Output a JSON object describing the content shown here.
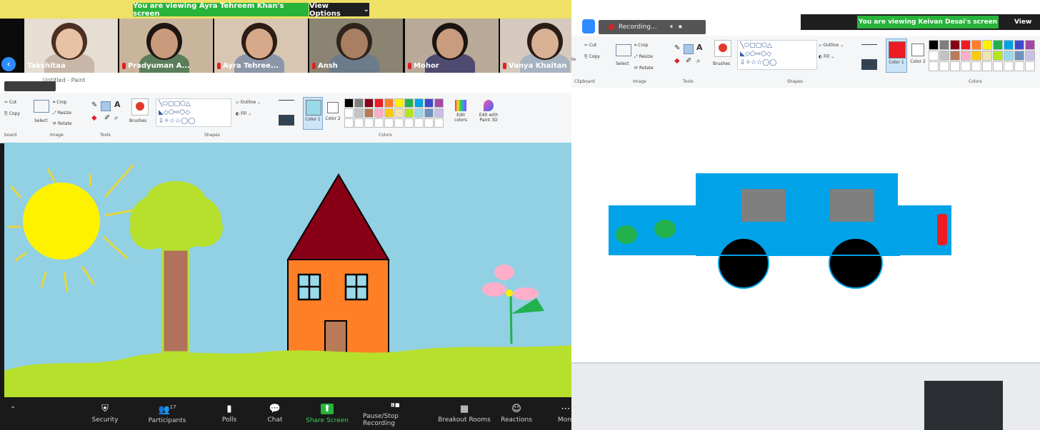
{
  "left_share": {
    "banner": "You are viewing Ayra Tehreem Khan's screen",
    "view_options": "View Options",
    "participants": [
      {
        "name": "Takshitaa",
        "muted": false,
        "bg": "#e6ddd3",
        "skin": "#e8c2a4",
        "hair": "#4a2f22",
        "shirt": "#c8b7a8"
      },
      {
        "name": "Pradyuman A...",
        "muted": true,
        "bg": "#c9b59c",
        "skin": "#c99a7c",
        "hair": "#1d1612",
        "shirt": "#5c7d5a"
      },
      {
        "name": "Ayra Tehree...",
        "muted": true,
        "bg": "#d8c6b3",
        "skin": "#d6a98a",
        "hair": "#2b1c14",
        "shirt": "#8b96a8"
      },
      {
        "name": "Ansh",
        "muted": true,
        "bg": "#8c8472",
        "skin": "#a87f62",
        "hair": "#2d241c",
        "shirt": "#6c7b8a"
      },
      {
        "name": "Mohor",
        "muted": true,
        "bg": "#b9a999",
        "skin": "#c99b7f",
        "hair": "#1a1410",
        "shirt": "#4f4a70"
      },
      {
        "name": "Vanya Khaitan",
        "muted": true,
        "bg": "#d5cabd",
        "skin": "#d8b094",
        "hair": "#2a1d16",
        "shirt": "#a7b3c0"
      }
    ],
    "app_title": "Untitled - Paint",
    "ribbon": {
      "clipboard": {
        "cut": "Cut",
        "copy": "Copy",
        "group": "board"
      },
      "image": {
        "select": "Select",
        "crop": "Crop",
        "resize": "Resize",
        "rotate": "Rotate",
        "group": "Image"
      },
      "tools": {
        "group": "Tools"
      },
      "brushes": "Brushes",
      "shapes": {
        "outline": "Outline",
        "fill": "Fill",
        "group": "Shapes"
      },
      "size": "Size",
      "color1": "Color 1",
      "color2": "Color 2",
      "colors_group": "Colors",
      "edit_colors": "Edit colors",
      "edit_paint3d": "Edit with Paint 3D"
    },
    "palette": [
      "#000000",
      "#7f7f7f",
      "#880015",
      "#ed1c24",
      "#ff7f27",
      "#fff200",
      "#22b14c",
      "#00a2e8",
      "#3f48cc",
      "#a349a4",
      "#ffffff",
      "#c3c3c3",
      "#b97a57",
      "#ffaec9",
      "#ffc90e",
      "#efe4b0",
      "#b5e61d",
      "#99d9ea",
      "#7092be",
      "#c8bfe7"
    ],
    "toolbar": [
      {
        "id": "security",
        "label": "Security",
        "icon": "shield-icon",
        "glyph": "⛨"
      },
      {
        "id": "participants",
        "label": "Participants",
        "icon": "participants-icon",
        "glyph": "👥",
        "count": "17"
      },
      {
        "id": "polls",
        "label": "Polls",
        "icon": "polls-icon",
        "glyph": "▮"
      },
      {
        "id": "chat",
        "label": "Chat",
        "icon": "chat-icon",
        "glyph": "💬"
      },
      {
        "id": "share",
        "label": "Share Screen",
        "icon": "share-screen-icon",
        "glyph": "⬆"
      },
      {
        "id": "record",
        "label": "Pause/Stop Recording",
        "icon": "pause-stop-icon",
        "glyph": "⏸⏹"
      },
      {
        "id": "breakout",
        "label": "Breakout Rooms",
        "icon": "breakout-rooms-icon",
        "glyph": "▦"
      },
      {
        "id": "reactions",
        "label": "Reactions",
        "icon": "reactions-icon",
        "glyph": "☺"
      },
      {
        "id": "more",
        "label": "More",
        "icon": "more-icon",
        "glyph": "⋯"
      }
    ]
  },
  "right_share": {
    "banner": "You are viewing Keivan Desai's screen",
    "view_options": "View",
    "recording": "Recording...",
    "ribbon": {
      "cut": "Cut",
      "copy": "Copy",
      "paste": "te",
      "select": "Select",
      "crop": "Crop",
      "resize": "Resize",
      "rotate": "Rotate",
      "brushes": "Brushes",
      "outline": "Outline",
      "fill": "Fill",
      "size": "Size",
      "color1": "Color 1",
      "color2": "Color 2",
      "groups": {
        "clipboard": "Clipboard",
        "image": "Image",
        "tools": "Tools",
        "shapes": "Shapes",
        "colors": "Colors"
      }
    },
    "palette": [
      "#000000",
      "#7f7f7f",
      "#880015",
      "#ed1c24",
      "#ff7f27",
      "#fff200",
      "#22b14c",
      "#00a2e8",
      "#3f48cc",
      "#a349a4",
      "#ffffff",
      "#c3c3c3",
      "#b97a57",
      "#ffaec9",
      "#ffc90e",
      "#efe4b0",
      "#b5e61d",
      "#99d9ea",
      "#7092be",
      "#c8bfe7"
    ]
  }
}
